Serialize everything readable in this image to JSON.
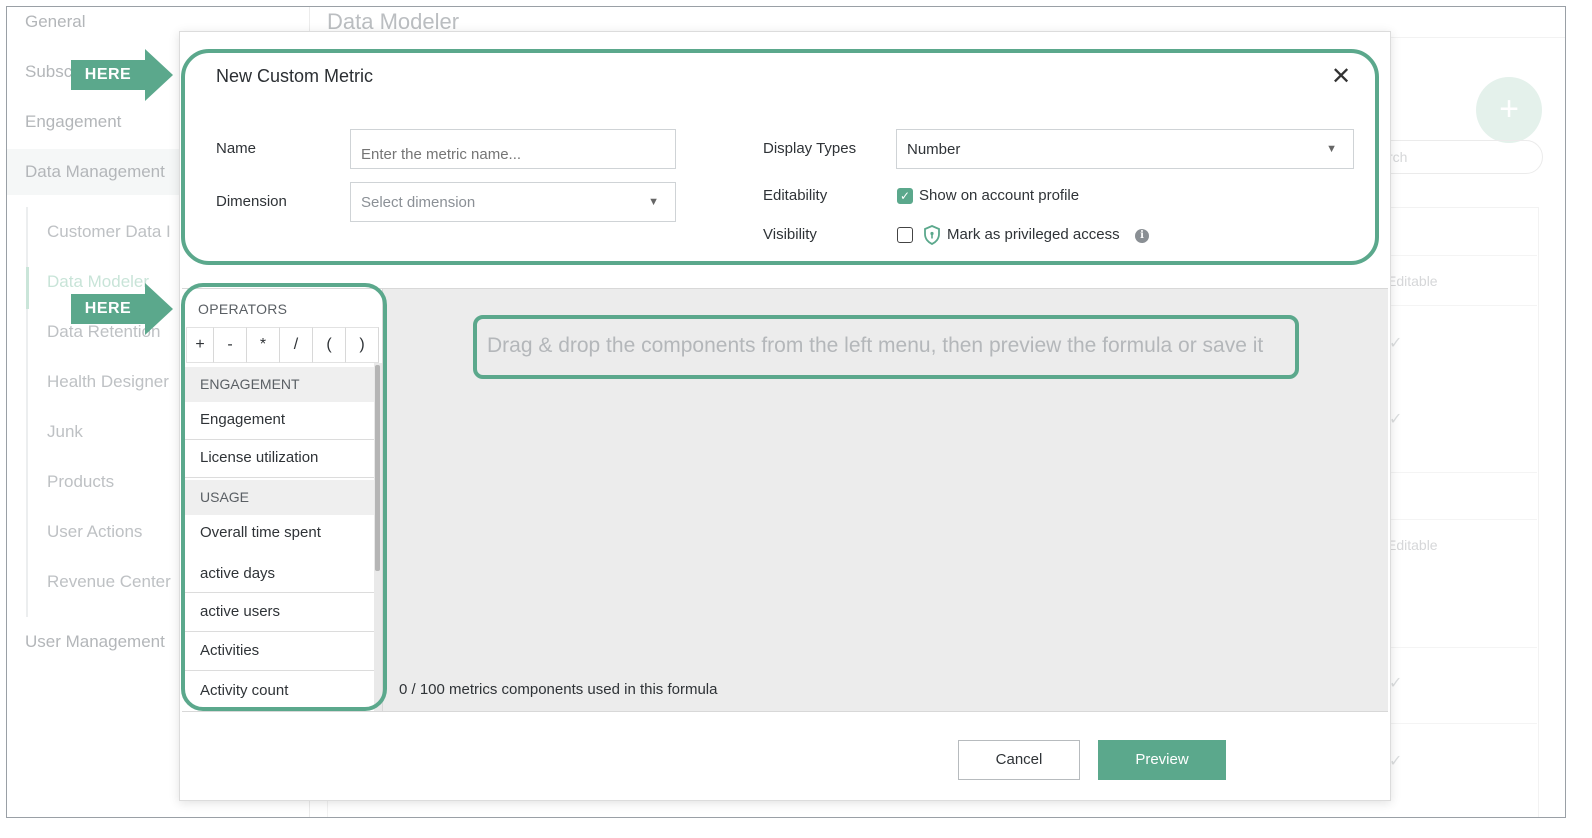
{
  "background": {
    "sidebar": [
      "General",
      "Subsc",
      "Engagement",
      "Data Management",
      "User Management"
    ],
    "sub_items": [
      "Customer Data I",
      "Data Modeler",
      "Data Retention",
      "Health Designer",
      "Junk",
      "Products",
      "User Actions",
      "Revenue Center"
    ],
    "page_title": "Data Modeler",
    "search_partial": "rch",
    "col_editable": "Editable",
    "fab": "+",
    "check": "✓"
  },
  "modal": {
    "title": "New Custom Metric",
    "close": "✕",
    "name_label": "Name",
    "name_placeholder": "Enter the metric name...",
    "dimension_label": "Dimension",
    "dimension_value": "Select dimension",
    "display_types_label": "Display Types",
    "display_types_value": "Number",
    "editability_label": "Editability",
    "editability_text": "Show on account profile",
    "editability_checked": true,
    "visibility_label": "Visibility",
    "visibility_text": "Mark as privileged access",
    "visibility_checked": false,
    "info": "i"
  },
  "builder": {
    "operators_header": "OPERATORS",
    "operators": [
      "+",
      "-",
      "*",
      "/",
      "(",
      ")"
    ],
    "groups": [
      {
        "title": "ENGAGEMENT",
        "items": [
          "Engagement",
          "License utilization"
        ]
      },
      {
        "title": "USAGE",
        "items": [
          "Overall time spent",
          "active days",
          "active users",
          "Activities",
          "Activity count"
        ]
      }
    ],
    "hint": "Drag & drop the components from the left menu, then preview the formula or save it",
    "counter": "0 / 100 metrics components used in this formula"
  },
  "footer": {
    "cancel": "Cancel",
    "preview": "Preview"
  },
  "annotations": {
    "arrow_label": "HERE",
    "accent": "#5ba88c"
  }
}
